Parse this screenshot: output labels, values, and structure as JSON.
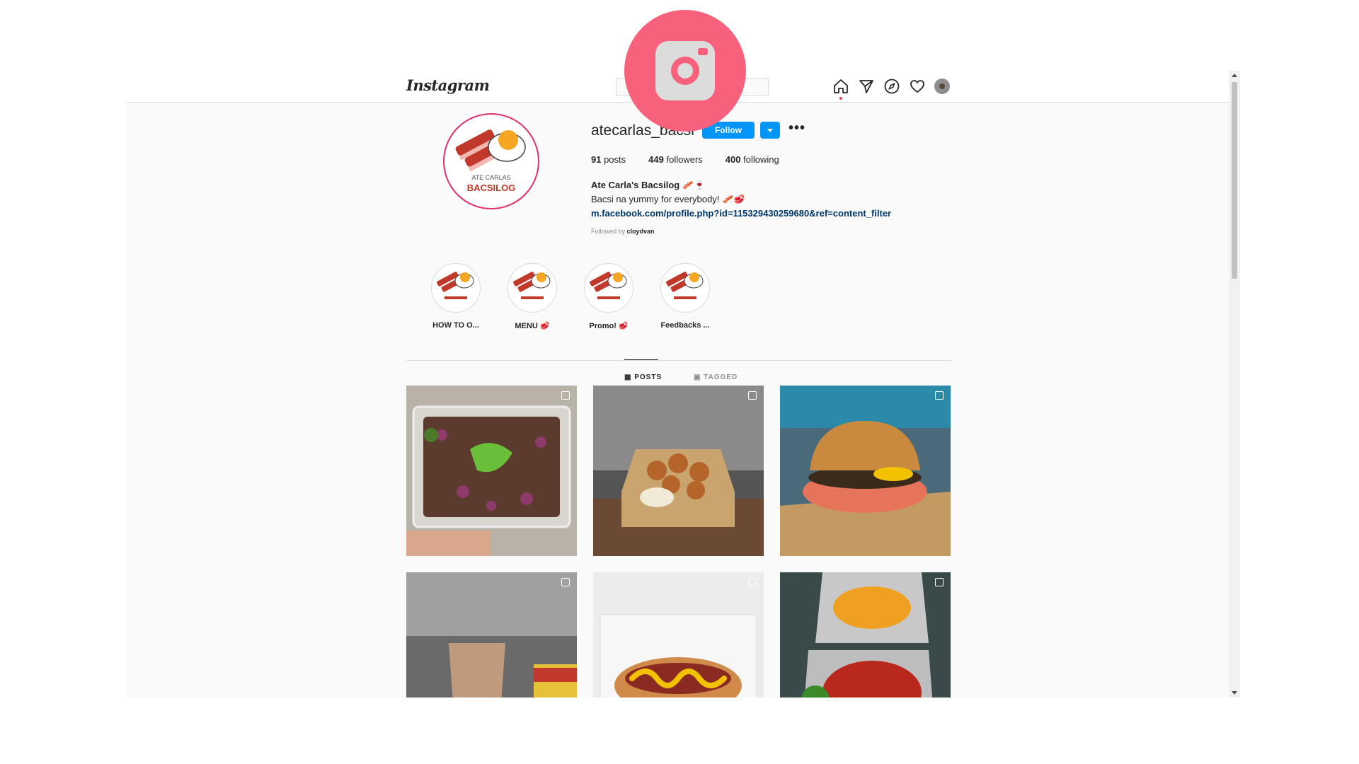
{
  "nav": {
    "logo": "Instagram",
    "icons": [
      "home-icon",
      "direct-message-icon",
      "explore-icon",
      "activity-heart-icon",
      "profile-avatar-icon"
    ]
  },
  "profile": {
    "username": "atecarlas_bacsi",
    "follow_label": "Follow",
    "more_label": "•••",
    "stats": {
      "posts_count": "91",
      "posts_label": " posts",
      "followers_count": "449",
      "followers_label": " followers",
      "following_count": "400",
      "following_label": " following"
    },
    "bio": {
      "name": "Ate Carla's Bacsilog 🥓🍷",
      "line": "Bacsi na yummy for everybody! 🥓🥩",
      "link": "m.facebook.com/profile.php?id=115329430259680&ref=content_filter"
    },
    "followed_by_prefix": "Followed by ",
    "followed_by_user": "cloydvan",
    "logo_text_top": "ATE CARLAS",
    "logo_text_bottom": "BACSILOG"
  },
  "highlights": [
    {
      "label": "HOW TO O..."
    },
    {
      "label": "MENU 🥩"
    },
    {
      "label": "Promo! 🥩"
    },
    {
      "label": "Feedbacks ..."
    }
  ],
  "tabs": {
    "posts": "▦ POSTS",
    "tagged": "▣ TAGGED"
  },
  "colors": {
    "follow_button": "#0095f6",
    "badge": "#f7617c",
    "ring": "#e1306c"
  },
  "posts": [
    {
      "subject": "sisig-with-onions-and-peppers"
    },
    {
      "subject": "fried-nuggets-with-dip"
    },
    {
      "subject": "burger"
    },
    {
      "subject": "iced-drink-with-evaporada"
    },
    {
      "subject": "hotdog-sandwich"
    },
    {
      "subject": "cheese-and-meat-boxes"
    }
  ],
  "overlay_badge": "instagram-camera-icon"
}
